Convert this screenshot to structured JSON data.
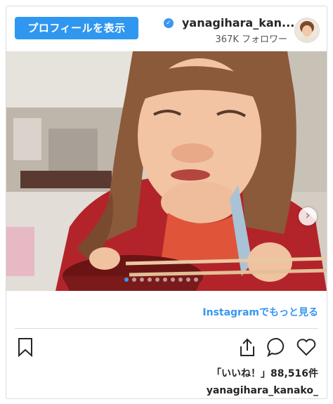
{
  "header": {
    "profile_button_label": "プロフィールを表示",
    "username": "yanagihara_kan...",
    "followers": "367K フォロワー",
    "verified_icon": "verified-badge-icon"
  },
  "photo": {
    "next_icon": "chevron-right-icon",
    "carousel_count": 10,
    "carousel_active": 0
  },
  "footer": {
    "view_more_link": "Instagramでもっと見る",
    "like_icon": "heart-icon",
    "comment_icon": "comment-icon",
    "share_icon": "share-icon",
    "save_icon": "bookmark-icon",
    "likes_text": "「いいね！」88,516件",
    "account_handle": "yanagihara_kanako_"
  },
  "colors": {
    "accent": "#3897f0",
    "button": "#2f97f0",
    "sweater": "#b3242a"
  }
}
